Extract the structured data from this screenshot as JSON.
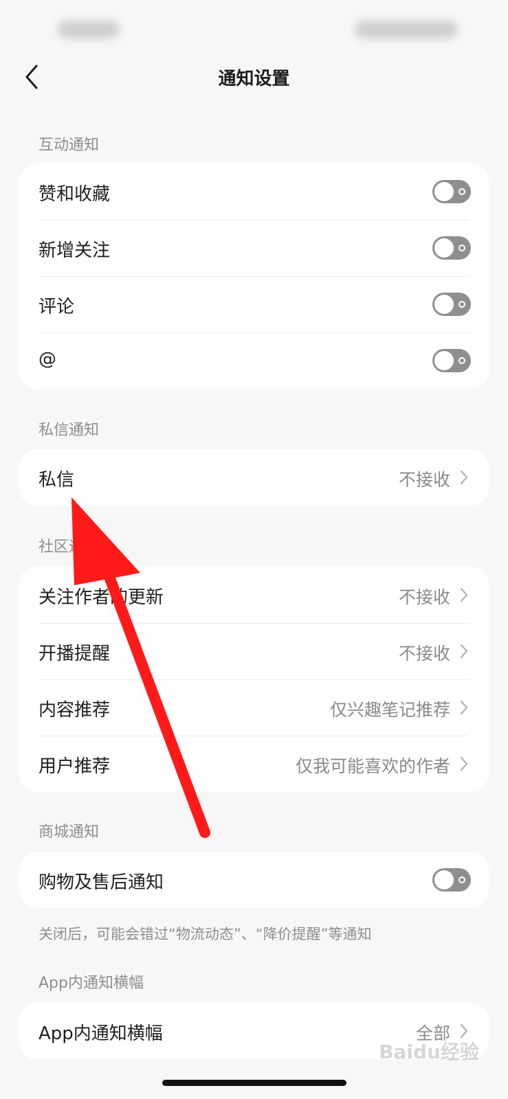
{
  "nav": {
    "title": "通知设置"
  },
  "sections": {
    "interaction": {
      "label": "互动通知",
      "rows": [
        {
          "label": "赞和收藏",
          "enabled": false
        },
        {
          "label": "新增关注",
          "enabled": false
        },
        {
          "label": "评论",
          "enabled": false
        },
        {
          "label": "@",
          "enabled": false
        }
      ]
    },
    "private_message": {
      "label": "私信通知",
      "rows": [
        {
          "label": "私信",
          "value": "不接收"
        }
      ]
    },
    "community": {
      "label": "社区通知",
      "rows": [
        {
          "label": "关注作者的更新",
          "value": "不接收"
        },
        {
          "label": "开播提醒",
          "value": "不接收"
        },
        {
          "label": "内容推荐",
          "value": "仅兴趣笔记推荐"
        },
        {
          "label": "用户推荐",
          "value": "仅我可能喜欢的作者"
        }
      ]
    },
    "mall": {
      "label": "商城通知",
      "rows": [
        {
          "label": "购物及售后通知",
          "enabled": false
        }
      ],
      "hint": "关闭后，可能会错过“物流动态”、“降价提醒”等通知"
    },
    "banner": {
      "label": "App内通知横幅",
      "rows": [
        {
          "label": "App内通知横幅",
          "value": "全部"
        }
      ]
    }
  },
  "watermark": "Baidu经验",
  "colors": {
    "background": "#f7f7f7",
    "card": "#ffffff",
    "toggle_off": "#8f8f93",
    "annotation_arrow": "#ff1a1a"
  }
}
